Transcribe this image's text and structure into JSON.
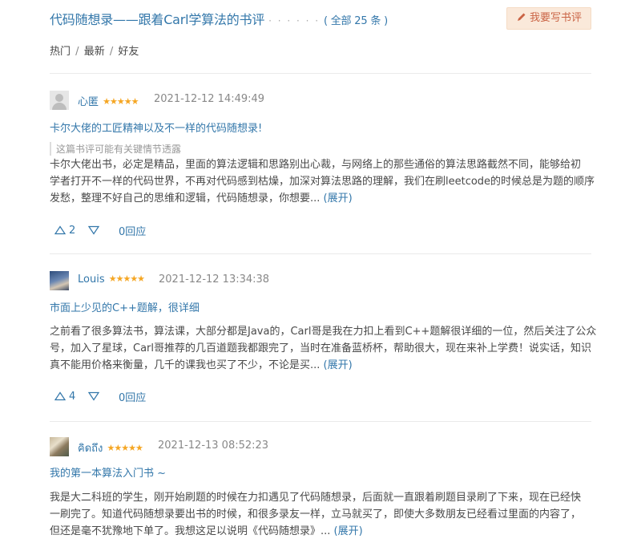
{
  "header": {
    "title": "代码随想录——跟着Carl学算法的书评",
    "dots": "· · · · · ·",
    "count": "( 全部 25 条 )",
    "write_button": "我要写书评",
    "write_icon": "pencil-icon"
  },
  "sort": {
    "hot": "热门",
    "latest": "最新",
    "friends": "好友",
    "separator": "/"
  },
  "reviews": [
    {
      "user": "心匿",
      "stars": "★★★★★",
      "rating": 5,
      "time": "2021-12-12 14:49:49",
      "title": "卡尔大佬的工匠精神以及不一样的代码随想录!",
      "spoiler": "这篇书评可能有关键情节透露",
      "lines": [
        "卡尔大佬出书，必定是精品，里面的算法逻辑和思路别出心裁，与网络上的那些通俗的算法思路截然不同，能够给初",
        "学者打开不一样的代码世界，不再对代码感到枯燥，加深对算法思路的理解，我们在刷leetcode的时候总是为题的顺序",
        "发愁，整理不好自己的思维和逻辑，代码随想录，你想要..."
      ],
      "expand": "(展开)",
      "upvotes": "2",
      "reply": "0回应"
    },
    {
      "user": "Louis",
      "stars": "★★★★★",
      "rating": 5,
      "time": "2021-12-12 13:34:38",
      "title": "市面上少见的C++题解，很详细",
      "lines": [
        "之前看了很多算法书，算法课，大部分都是Java的，Carl哥是我在力扣上看到C++题解很详细的一位，然后关注了公众",
        "号，加入了星球，Carl哥推荐的几百道题我都跟完了，当时在准备蓝桥杯，帮助很大，现在来补上学费！说实话，知识",
        "真不能用价格来衡量，几千的课我也买了不少，不论是买..."
      ],
      "expand": "(展开)",
      "upvotes": "4",
      "reply": "0回应"
    },
    {
      "user": "คิดถึง",
      "stars": "★★★★★",
      "rating": 5,
      "time": "2021-12-13 08:52:23",
      "title": "我的第一本算法入门书 ~",
      "lines": [
        "我是大二科班的学生，刚开始刷题的时候在力扣遇见了代码随想录，后面就一直跟着刷题目录刷了下来，现在已经快",
        "一刷完了。知道代码随想录要出书的时候，和很多录友一样，立马就买了，即使大多数朋友已经看过里面的内容了，",
        "但还是毫不犹豫地下单了。我想这足以说明《代码随想录》..."
      ],
      "expand": "(展开)"
    }
  ],
  "colors": {
    "link": "#3377aa",
    "star": "#f5a623",
    "button_bg": "#fae9da",
    "button_text": "#ca6445"
  }
}
